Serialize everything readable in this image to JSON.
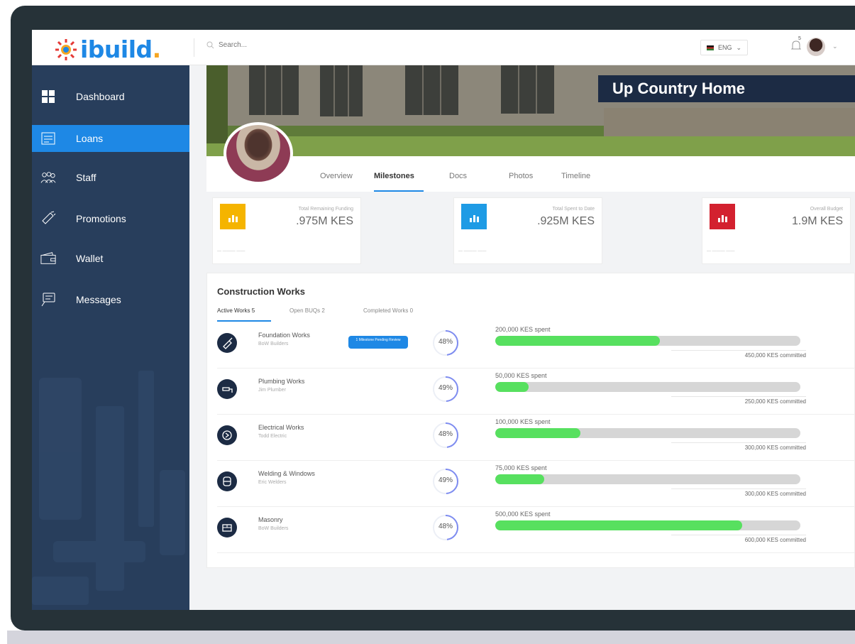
{
  "app": {
    "brand": "ibuild",
    "brand_dot": "."
  },
  "topbar": {
    "search_placeholder": "Search...",
    "language": "ENG",
    "notification_count": "5"
  },
  "sidebar": {
    "items": [
      {
        "label": "Dashboard",
        "icon": "dashboard-grid-icon",
        "active": false
      },
      {
        "label": "Loans",
        "icon": "calendar-list-icon",
        "active": true
      },
      {
        "label": "Staff",
        "icon": "people-icon",
        "active": false
      },
      {
        "label": "Promotions",
        "icon": "megaphone-icon",
        "active": false
      },
      {
        "label": "Wallet",
        "icon": "wallet-icon",
        "active": false
      },
      {
        "label": "Messages",
        "icon": "chat-icon",
        "active": false
      }
    ]
  },
  "project": {
    "title": "Up Country Home",
    "tabs": [
      "Overview",
      "Milestones",
      "Docs",
      "Photos",
      "Timeline"
    ],
    "active_tab": "Milestones"
  },
  "stats": [
    {
      "label": "Total Remaining Funding",
      "value": ".975M KES",
      "color": "#f5b400",
      "foot": "— ——— ——"
    },
    {
      "label": "Total Spent to Date",
      "value": ".925M KES",
      "color": "#1e9be5",
      "foot": "— ——— ——"
    },
    {
      "label": "Overall Budget",
      "value": "1.9M KES",
      "color": "#d3212f",
      "foot": "— ——— ——"
    }
  ],
  "works": {
    "title": "Construction Works",
    "tabs": [
      "Active Works 5",
      "Open BUQs 2",
      "Completed Works 0"
    ],
    "rows": [
      {
        "name": "Foundation Works",
        "sub": "BoW Builders",
        "badge": "1 Milestone Pending Review",
        "percent_label": "48%",
        "percent": 48,
        "spent": "200,000 KES spent",
        "committed": "450,000 KES committed",
        "fill": 0.54,
        "icon": "trowel-icon"
      },
      {
        "name": "Plumbing Works",
        "sub": "Jim Plumber",
        "badge": "",
        "percent_label": "49%",
        "percent": 49,
        "spent": "50,000 KES spent",
        "committed": "250,000 KES committed",
        "fill": 0.11,
        "icon": "faucet-icon"
      },
      {
        "name": "Electrical Works",
        "sub": "Todd Electric",
        "badge": "",
        "percent_label": "48%",
        "percent": 48,
        "spent": "100,000 KES spent",
        "committed": "300,000 KES committed",
        "fill": 0.28,
        "icon": "plug-icon"
      },
      {
        "name": "Welding & Windows",
        "sub": "Eric Welders",
        "badge": "",
        "percent_label": "49%",
        "percent": 49,
        "spent": "75,000 KES spent",
        "committed": "300,000 KES committed",
        "fill": 0.16,
        "icon": "window-icon"
      },
      {
        "name": "Masonry",
        "sub": "BoW Builders",
        "badge": "",
        "percent_label": "48%",
        "percent": 48,
        "spent": "500,000 KES spent",
        "committed": "600,000 KES committed",
        "fill": 0.81,
        "icon": "brick-icon"
      }
    ]
  }
}
